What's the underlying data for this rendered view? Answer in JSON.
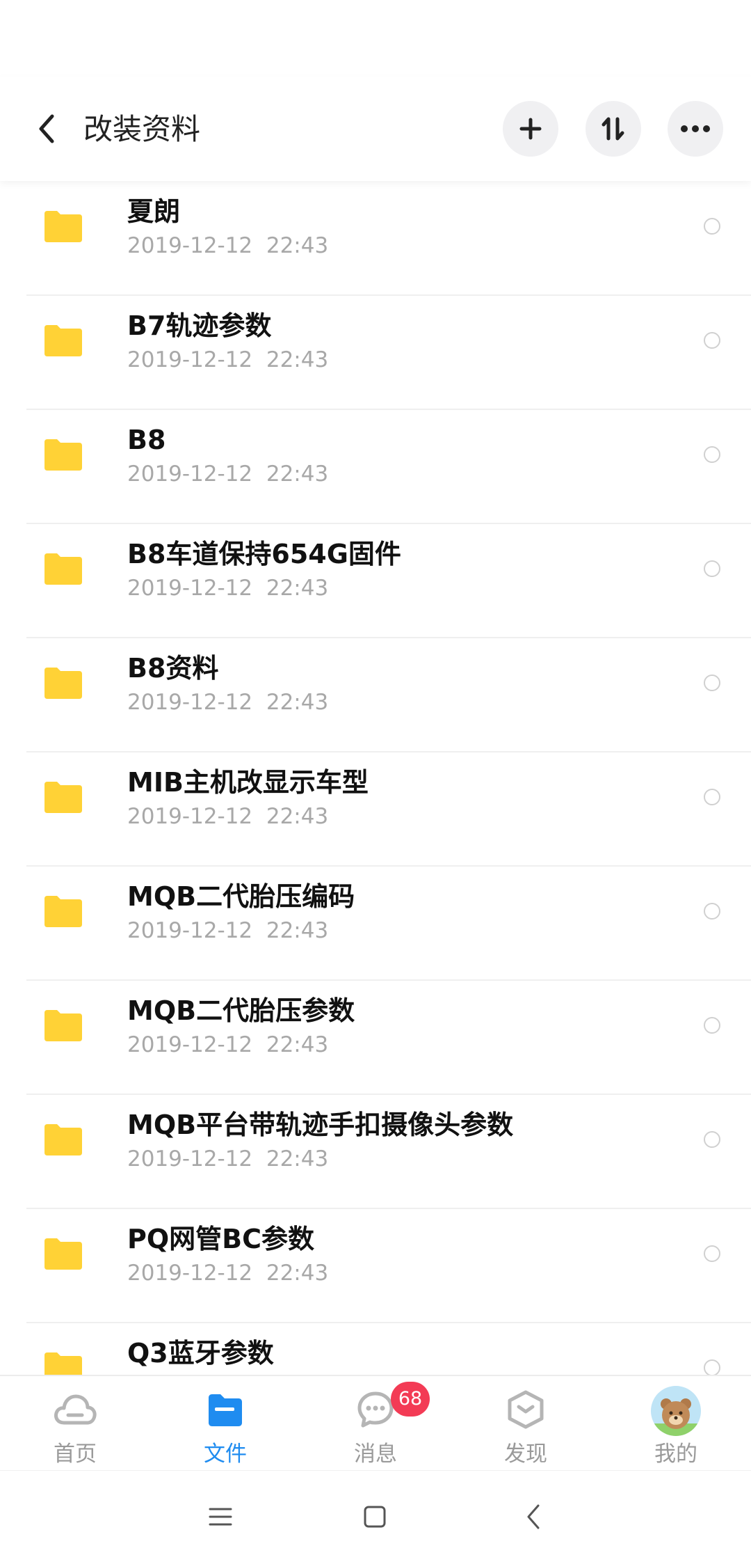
{
  "header": {
    "title": "改装资料"
  },
  "files": [
    {
      "name": "夏朗",
      "date": "2019-12-12  22:43"
    },
    {
      "name": "B7轨迹参数",
      "date": "2019-12-12  22:43"
    },
    {
      "name": "B8",
      "date": "2019-12-12  22:43"
    },
    {
      "name": "B8车道保持654G固件",
      "date": "2019-12-12  22:43"
    },
    {
      "name": "B8资料",
      "date": "2019-12-12  22:43"
    },
    {
      "name": "MIB主机改显示车型",
      "date": "2019-12-12  22:43"
    },
    {
      "name": "MQB二代胎压编码",
      "date": "2019-12-12  22:43"
    },
    {
      "name": "MQB二代胎压参数",
      "date": "2019-12-12  22:43"
    },
    {
      "name": "MQB平台带轨迹手扣摄像头参数",
      "date": "2019-12-12  22:43"
    },
    {
      "name": "PQ网管BC参数",
      "date": "2019-12-12  22:43"
    },
    {
      "name": "Q3蓝牙参数",
      "date": ""
    }
  ],
  "tabs": [
    {
      "label": "首页",
      "icon": "cloud-icon"
    },
    {
      "label": "文件",
      "icon": "folder-icon"
    },
    {
      "label": "消息",
      "icon": "chat-icon",
      "badge": "68"
    },
    {
      "label": "发现",
      "icon": "discover-icon"
    },
    {
      "label": "我的",
      "icon": "avatar"
    }
  ],
  "colors": {
    "folder": "#FFD236",
    "accent": "#1F8CF0",
    "badge": "#F33B55",
    "secondary_text": "#A8A8A8"
  }
}
